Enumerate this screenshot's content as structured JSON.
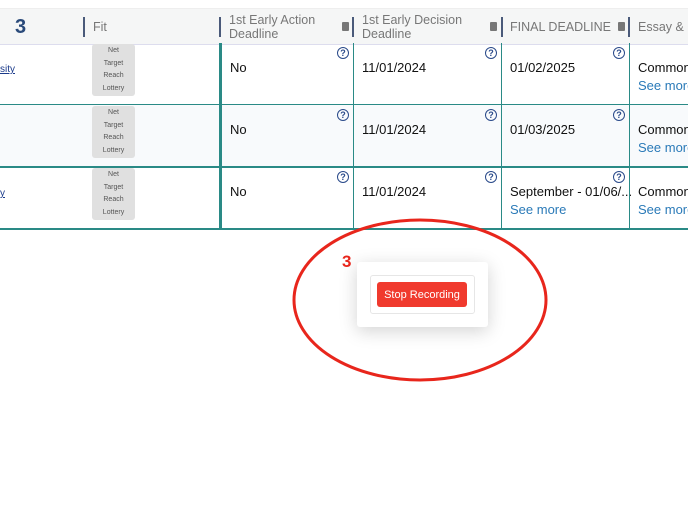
{
  "header": {
    "count": "3",
    "columns": [
      "Fit",
      "1st Early Action Deadline",
      "1st Early Decision Deadline",
      "FINAL DEADLINE",
      "Essay & O"
    ]
  },
  "fit_options": [
    "Net",
    "Target",
    "Reach",
    "Lottery"
  ],
  "rows": [
    {
      "name": "sity",
      "ea": "No",
      "ed": "11/01/2024",
      "final": "01/02/2025",
      "final_more": "",
      "essay": "Common",
      "essay_more": "See more"
    },
    {
      "name": "",
      "ea": "No",
      "ed": "11/01/2024",
      "final": "01/03/2025",
      "final_more": "",
      "essay": "Common",
      "essay_more": "See more"
    },
    {
      "name": "y",
      "ea": "No",
      "ed": "11/01/2024",
      "final": "September - 01/06/...",
      "final_more": "See more",
      "essay": "Common",
      "essay_more": "See more"
    }
  ],
  "popup": {
    "step": "3",
    "button": "Stop Recording",
    "accent": "#f03a2e"
  }
}
